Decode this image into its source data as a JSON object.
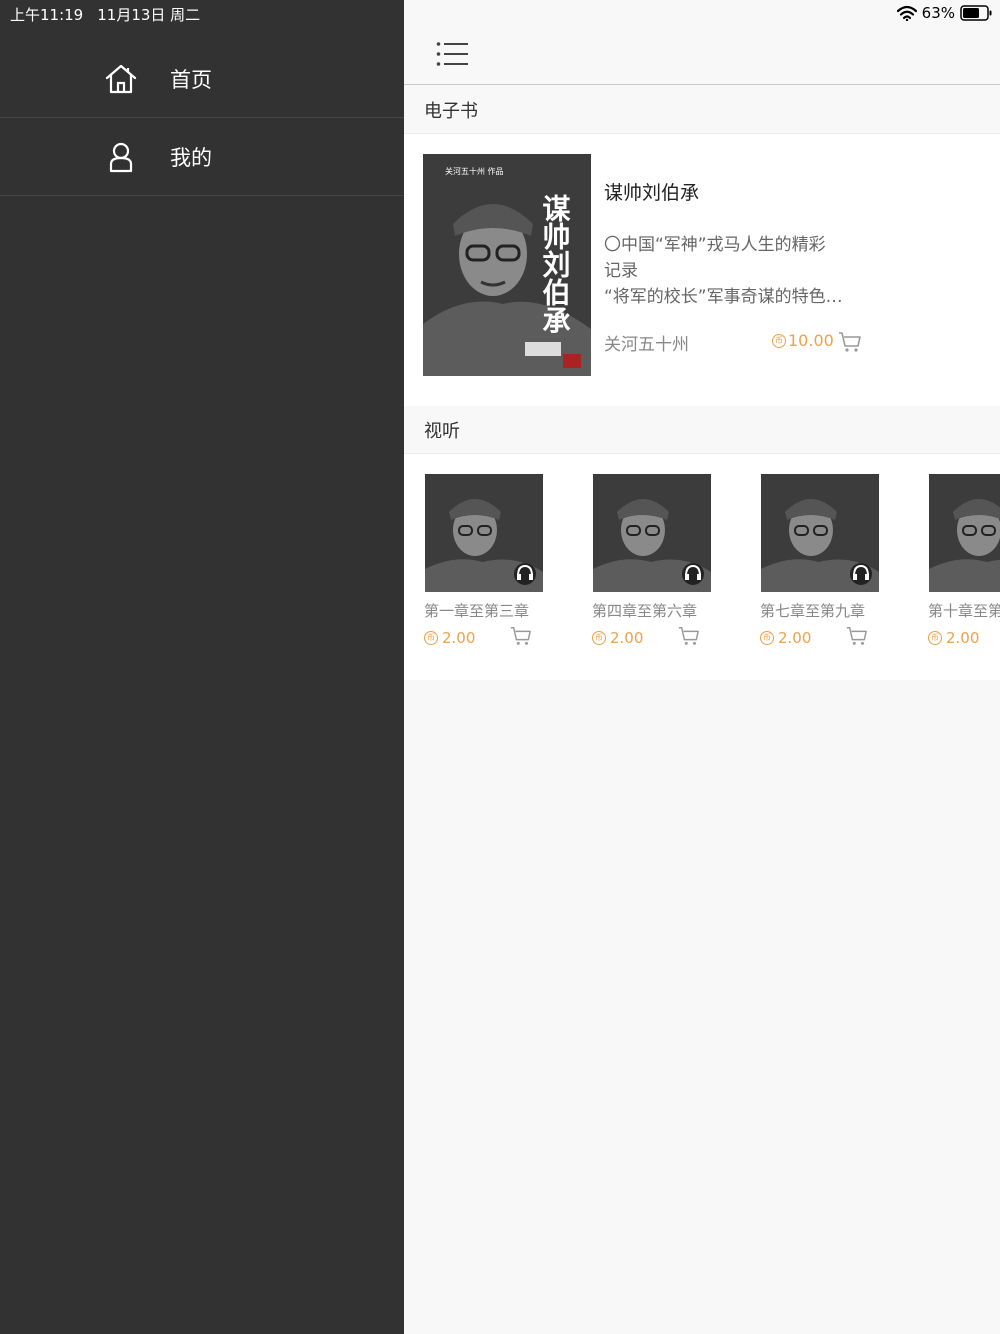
{
  "status": {
    "time": "上午11:19",
    "date": "11月13日 周二",
    "battery": "63%"
  },
  "sidebar": {
    "items": [
      {
        "label": "首页",
        "icon": "home-icon"
      },
      {
        "label": "我的",
        "icon": "user-icon"
      }
    ]
  },
  "ebook_section": {
    "title": "电子书",
    "item": {
      "title": "谋帅刘伯承",
      "desc_line1": "〇中国“军神”戎马人生的精彩",
      "desc_line2": "记录",
      "desc_line3": "“将军的校长”军事奇谋的特色…",
      "author": "关河五十州",
      "price": "10.00",
      "cover_title": "谋帅刘伯承",
      "cover_author": "关河五十州 作品"
    }
  },
  "audio_section": {
    "title": "视听",
    "items": [
      {
        "title": "第一章至第三章",
        "price": "2.00"
      },
      {
        "title": "第四章至第六章",
        "price": "2.00"
      },
      {
        "title": "第七章至第九章",
        "price": "2.00"
      },
      {
        "title": "第十章至第",
        "price": "2.00"
      }
    ]
  },
  "colors": {
    "sidebar_bg": "#323232",
    "accent": "#f0a04a"
  }
}
